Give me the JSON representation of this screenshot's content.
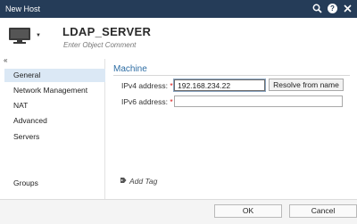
{
  "window": {
    "title": "New Host",
    "icons": [
      "search-icon",
      "help-icon",
      "close-icon"
    ]
  },
  "header": {
    "object_name": "LDAP_SERVER",
    "comment_placeholder": "Enter Object Comment",
    "icon": "monitor-icon"
  },
  "sidebar": {
    "collapse_label": "«",
    "items": [
      {
        "label": "General",
        "active": true
      },
      {
        "label": "Network Management",
        "active": false
      },
      {
        "label": "NAT",
        "active": false
      },
      {
        "label": "Advanced",
        "active": false
      },
      {
        "label": "Servers",
        "active": false
      },
      {
        "label": "Groups",
        "active": false
      }
    ]
  },
  "main": {
    "section_title": "Machine",
    "ipv4": {
      "label": "IPv4 address:",
      "required_mark": "*",
      "value": "192.168.234.22"
    },
    "ipv6": {
      "label": "IPv6 address:",
      "required_mark": "*",
      "value": ""
    },
    "resolve_button": "Resolve from name",
    "add_tag": "Add Tag"
  },
  "footer": {
    "ok_label": "OK",
    "cancel_label": "Cancel"
  },
  "colors": {
    "titlebar": "#253c58",
    "accent": "#2e6da4",
    "active_nav": "#dbe8f5"
  }
}
